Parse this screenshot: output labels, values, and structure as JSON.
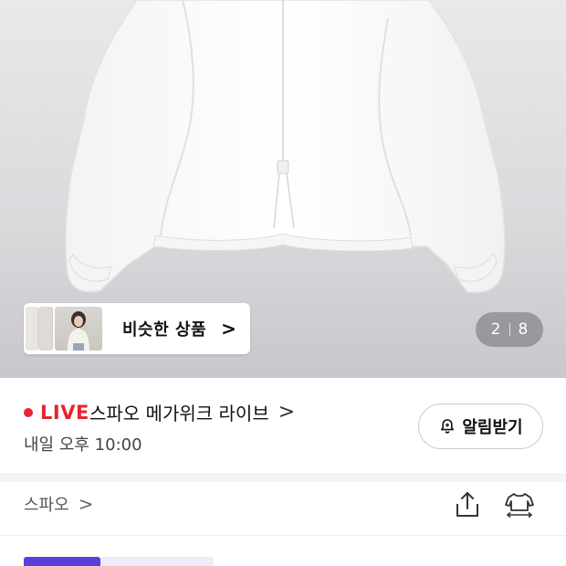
{
  "gallery": {
    "similar_label": "비슷한 상품",
    "similar_arrow": ">",
    "current_page": "2",
    "total_pages": "8"
  },
  "live": {
    "badge": "LIVE",
    "title": "스파오 메가위크 라이브",
    "title_arrow": ">",
    "time": "내일 오후 10:00",
    "notify_label": "알림받기"
  },
  "brand": {
    "name": "스파오",
    "arrow": ">"
  },
  "icons": {
    "share": "share-icon",
    "size": "size-guide-icon",
    "bell": "bell-plus-icon"
  },
  "colors": {
    "live_red": "#e8232e",
    "accent_purple": "#5a3fd8"
  }
}
